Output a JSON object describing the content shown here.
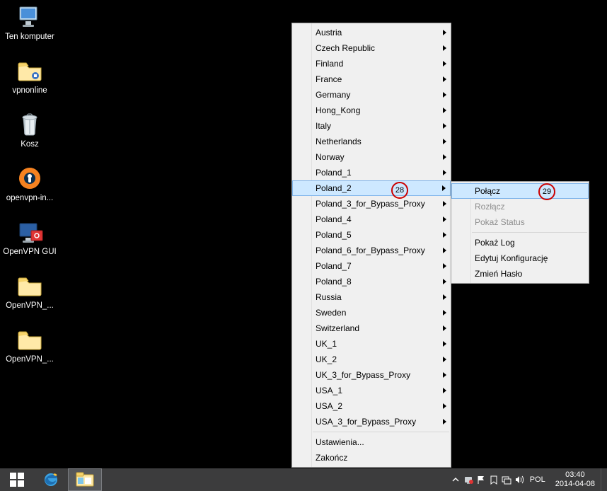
{
  "desktop_icons": [
    {
      "name": "ten-komputer",
      "label": "Ten komputer"
    },
    {
      "name": "vpnonline",
      "label": "vpnonline"
    },
    {
      "name": "kosz",
      "label": "Kosz"
    },
    {
      "name": "openvpn-installer",
      "label": "openvpn-in..."
    },
    {
      "name": "openvpn-gui",
      "label": "OpenVPN GUI"
    },
    {
      "name": "openvpn-folder-1",
      "label": "OpenVPN_..."
    },
    {
      "name": "openvpn-folder-2",
      "label": "OpenVPN_..."
    }
  ],
  "main_menu": {
    "items": [
      {
        "label": "Austria",
        "sub": true
      },
      {
        "label": "Czech Republic",
        "sub": true
      },
      {
        "label": "Finland",
        "sub": true
      },
      {
        "label": "France",
        "sub": true
      },
      {
        "label": "Germany",
        "sub": true
      },
      {
        "label": "Hong_Kong",
        "sub": true
      },
      {
        "label": "Italy",
        "sub": true
      },
      {
        "label": "Netherlands",
        "sub": true
      },
      {
        "label": "Norway",
        "sub": true
      },
      {
        "label": "Poland_1",
        "sub": true
      },
      {
        "label": "Poland_2",
        "sub": true,
        "hov": true
      },
      {
        "label": "Poland_3_for_Bypass_Proxy",
        "sub": true
      },
      {
        "label": "Poland_4",
        "sub": true
      },
      {
        "label": "Poland_5",
        "sub": true
      },
      {
        "label": "Poland_6_for_Bypass_Proxy",
        "sub": true
      },
      {
        "label": "Poland_7",
        "sub": true
      },
      {
        "label": "Poland_8",
        "sub": true
      },
      {
        "label": "Russia",
        "sub": true
      },
      {
        "label": "Sweden",
        "sub": true
      },
      {
        "label": "Switzerland",
        "sub": true
      },
      {
        "label": "UK_1",
        "sub": true
      },
      {
        "label": "UK_2",
        "sub": true
      },
      {
        "label": "UK_3_for_Bypass_Proxy",
        "sub": true
      },
      {
        "label": "USA_1",
        "sub": true
      },
      {
        "label": "USA_2",
        "sub": true
      },
      {
        "label": "USA_3_for_Bypass_Proxy",
        "sub": true
      }
    ],
    "footer": [
      {
        "label": "Ustawienia..."
      },
      {
        "label": "Zakończ"
      }
    ]
  },
  "sub_menu": {
    "items_top": [
      {
        "label": "Połącz",
        "hov": true
      },
      {
        "label": "Rozłącz",
        "dis": true
      },
      {
        "label": "Pokaż Status",
        "dis": true
      }
    ],
    "items_bottom": [
      {
        "label": "Pokaż Log"
      },
      {
        "label": "Edytuj Konfigurację"
      },
      {
        "label": "Zmień Hasło"
      }
    ]
  },
  "annotations": {
    "a28": "28",
    "a29": "29"
  },
  "taskbar": {
    "lang": "POL",
    "time": "03:40",
    "date": "2014-04-08"
  }
}
